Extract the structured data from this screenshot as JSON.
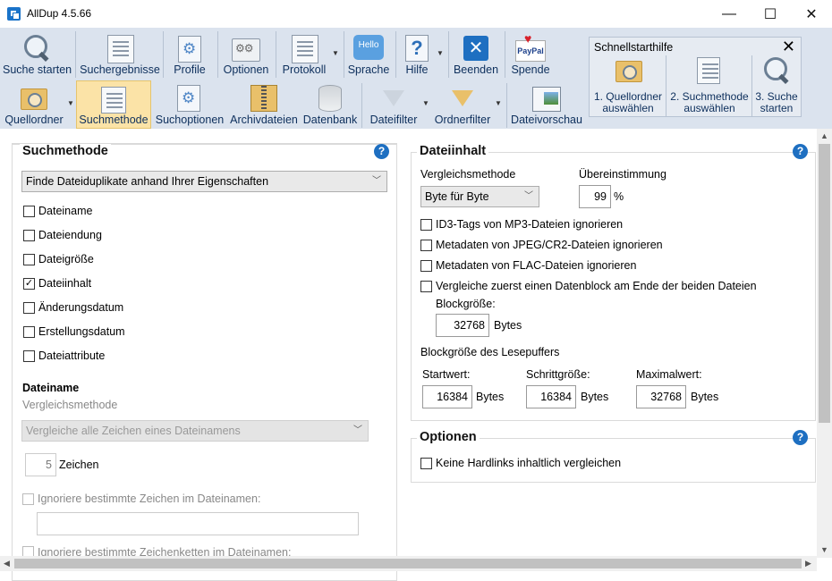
{
  "window": {
    "title": "AllDup 4.5.66",
    "min": "—",
    "max": "☐",
    "close": "✕"
  },
  "toolbar1": {
    "search_start": "Suche starten",
    "search_results": "Suchergebnisse",
    "profiles": "Profile",
    "options": "Optionen",
    "log": "Protokoll",
    "language": "Sprache",
    "help": "Hilfe",
    "exit": "Beenden",
    "donate": "Spende",
    "hello_icon_text": "Hello",
    "paypal_icon_text": "PayPal"
  },
  "toolbar2": {
    "source_folders": "Quellordner",
    "search_method": "Suchmethode",
    "search_options": "Suchoptionen",
    "archive_files": "Archivdateien",
    "database": "Datenbank",
    "file_filter": "Dateifilter",
    "folder_filter": "Ordnerfilter",
    "file_preview": "Dateivorschau"
  },
  "quickstart": {
    "title": "Schnellstarthilfe",
    "step1_line1": "1. Quellordner",
    "step1_line2": "auswählen",
    "step2_line1": "2. Suchmethode",
    "step2_line2": "auswählen",
    "step3_line1": "3. Suche",
    "step3_line2": "starten"
  },
  "left": {
    "title": "Suchmethode",
    "method_select": "Finde Dateiduplikate anhand Ihrer Eigenschaften",
    "checks": [
      {
        "label": "Dateiname",
        "checked": false
      },
      {
        "label": "Dateiendung",
        "checked": false
      },
      {
        "label": "Dateigröße",
        "checked": false
      },
      {
        "label": "Dateiinhalt",
        "checked": true
      },
      {
        "label": "Änderungsdatum",
        "checked": false
      },
      {
        "label": "Erstellungsdatum",
        "checked": false
      },
      {
        "label": "Dateiattribute",
        "checked": false
      }
    ],
    "filename_title": "Dateiname",
    "compare_method_label": "Vergleichsmethode",
    "compare_select": "Vergleiche alle Zeichen eines Dateinamens",
    "chars_value": "5",
    "chars_label": "Zeichen",
    "ignore_chars_label": "Ignoriere bestimmte Zeichen im Dateinamen:",
    "ignore_chars_value": "",
    "ignore_strings_label": "Ignoriere bestimmte Zeichenketten im Dateinamen:"
  },
  "right": {
    "content_title": "Dateiinhalt",
    "compare_method_label": "Vergleichsmethode",
    "compare_method_value": "Byte für Byte",
    "match_label": "Übereinstimmung",
    "match_value": "99",
    "percent": "%",
    "checks": [
      {
        "label": "ID3-Tags von MP3-Dateien ignorieren",
        "checked": false
      },
      {
        "label": "Metadaten von JPEG/CR2-Dateien ignorieren",
        "checked": false
      },
      {
        "label": "Metadaten von FLAC-Dateien ignorieren",
        "checked": false
      },
      {
        "label": "Vergleiche zuerst einen Datenblock am Ende der beiden Dateien",
        "checked": false
      }
    ],
    "block_size_label": "Blockgröße:",
    "block_size_value": "32768",
    "bytes": "Bytes",
    "buffer_title": "Blockgröße des Lesepuffers",
    "start_label": "Startwert:",
    "start_value": "16384",
    "step_label": "Schrittgröße:",
    "step_value": "16384",
    "max_label": "Maximalwert:",
    "max_value": "32768",
    "options_title": "Optionen",
    "hardlinks_label": "Keine Hardlinks inhaltlich vergleichen",
    "hardlinks_checked": false
  },
  "help_mark": "?",
  "check_mark": "✓"
}
